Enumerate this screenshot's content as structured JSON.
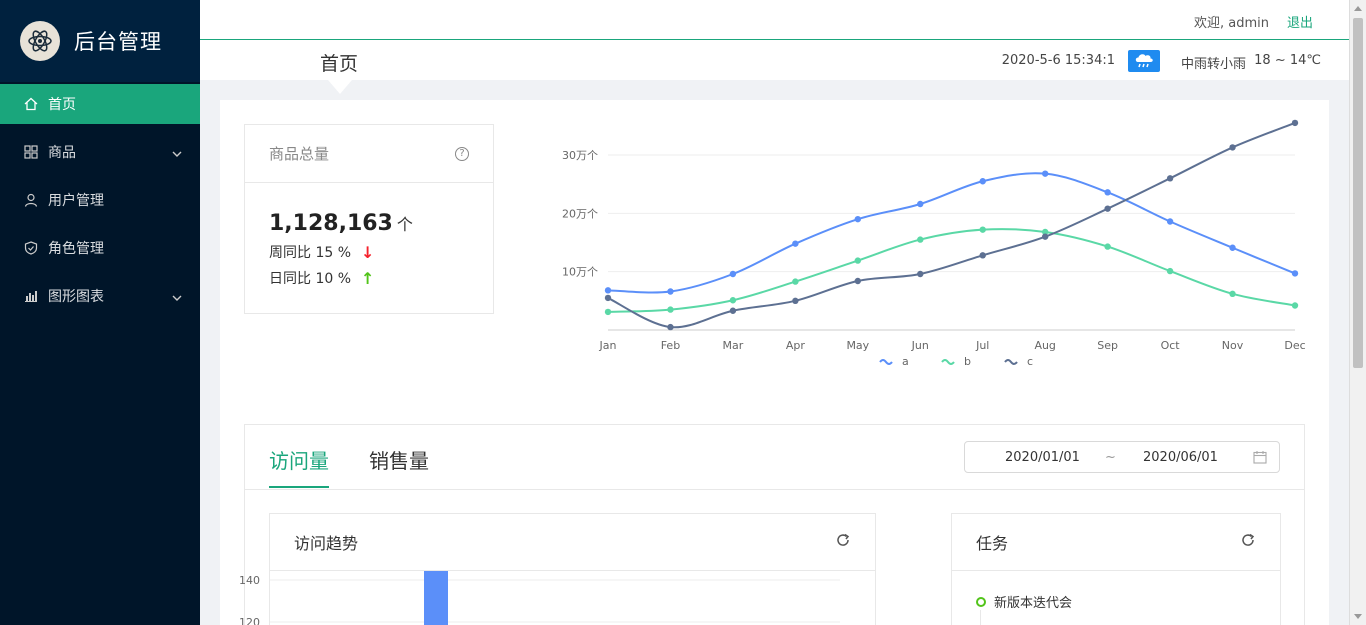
{
  "app": {
    "title": "后台管理"
  },
  "sidebar": {
    "items": [
      {
        "label": "首页",
        "icon": "home-icon",
        "active": true
      },
      {
        "label": "商品",
        "icon": "grid-icon",
        "expandable": true
      },
      {
        "label": "用户管理",
        "icon": "user-icon"
      },
      {
        "label": "角色管理",
        "icon": "shield-icon"
      },
      {
        "label": "图形图表",
        "icon": "chart-icon",
        "expandable": true
      }
    ]
  },
  "header": {
    "welcome": "欢迎, admin",
    "logout": "退出"
  },
  "breadcrumb": {
    "title": "首页",
    "datetime": "2020-5-6 15:34:1",
    "weather": "中雨转小雨",
    "temperature": "18 ~ 14℃",
    "weather_icon": "rain-cloud-icon"
  },
  "stat": {
    "title": "商品总量",
    "value": "1,128,163",
    "unit": "个",
    "week_label": "周同比 15 %",
    "day_label": "日同比 10 %"
  },
  "chart_data": {
    "type": "line",
    "x": [
      "Jan",
      "Feb",
      "Mar",
      "Apr",
      "May",
      "Jun",
      "Jul",
      "Aug",
      "Sep",
      "Oct",
      "Nov",
      "Dec"
    ],
    "yticks": [
      "10万个",
      "20万个",
      "30万个"
    ],
    "ylim": [
      0,
      360000
    ],
    "series": [
      {
        "name": "a",
        "color": "#5b8ff9",
        "values": [
          68000,
          66000,
          96000,
          148000,
          190000,
          216000,
          255000,
          268000,
          236000,
          186000,
          141000,
          97000
        ]
      },
      {
        "name": "b",
        "color": "#5ad8a6",
        "values": [
          31000,
          35000,
          51000,
          83000,
          119000,
          155000,
          172000,
          168000,
          143000,
          101000,
          62000,
          42000
        ]
      },
      {
        "name": "c",
        "color": "#5d7092",
        "values": [
          55000,
          5000,
          33000,
          50000,
          84000,
          96000,
          128000,
          160000,
          208000,
          260000,
          313000,
          355000
        ]
      }
    ],
    "legend": "bottom-center"
  },
  "tabs": {
    "items": [
      "访问量",
      "销售量"
    ],
    "active": 0,
    "range_start": "2020/01/01",
    "range_sep": "~",
    "range_end": "2020/06/01"
  },
  "visits": {
    "title": "访问趋势",
    "chart_data": {
      "type": "bar",
      "yticks": [
        "140",
        "120"
      ],
      "color": "#5b8ff9"
    }
  },
  "tasks": {
    "title": "任务",
    "items": [
      "新版本迭代会"
    ]
  }
}
